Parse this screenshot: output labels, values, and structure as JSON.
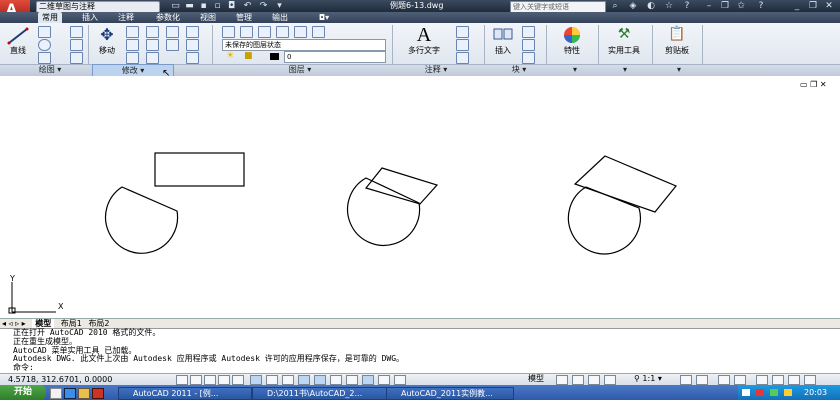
{
  "titlebar": {
    "logo_letter": "A",
    "workspace": "二维草图与注释",
    "document_title": "例题6-13.dwg",
    "search_placeholder": "键入关键字或短语"
  },
  "tabs": [
    "常用",
    "插入",
    "注释",
    "参数化",
    "视图",
    "管理",
    "输出"
  ],
  "ribbon": {
    "draw": {
      "line_label": "直线",
      "panel_title": "绘图"
    },
    "modify": {
      "move_label": "移动",
      "panel_title": "修改"
    },
    "layers": {
      "layer_state": "未保存的图层状态",
      "current_layer": "0",
      "panel_title": "图层"
    },
    "annotation": {
      "mtext_label": "多行文字",
      "panel_title": "注释"
    },
    "block": {
      "insert_label": "插入",
      "panel_title": "块"
    },
    "properties": {
      "label": "特性"
    },
    "utilities": {
      "label": "实用工具"
    },
    "clipboard": {
      "label": "剪贴板"
    }
  },
  "layout_tabs": [
    "模型",
    "布局1",
    "布局2"
  ],
  "command_lines": [
    "正在打开 AutoCAD 2010 格式的文件。",
    "正在重生成模型。",
    "AutoCAD 菜单实用工具 已加载。",
    "Autodesk DWG.  此文件上次由 Autodesk 应用程序或 Autodesk 许可的应用程序保存，是可靠的 DWG。",
    "命令:"
  ],
  "status": {
    "coordinates": "4.5718,  312.6701,  0.0000",
    "model_label": "模型",
    "annotation_scale": "1:1"
  },
  "ucs": {
    "x_label": "X",
    "y_label": "Y"
  },
  "taskbar": {
    "start_label": "开始",
    "tasks": [
      "AutoCAD 2011 - [例...",
      "D:\\2011书\\AutoCAD_2...",
      "AutoCAD_2011实例教..."
    ],
    "clock": "20:03"
  }
}
